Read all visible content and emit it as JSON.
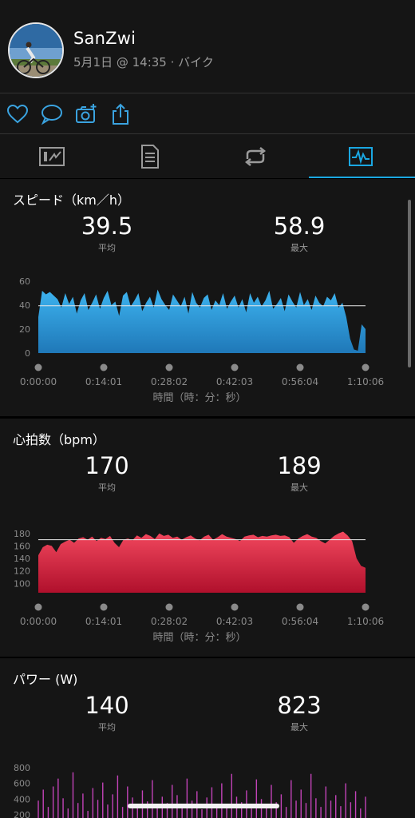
{
  "header": {
    "username": "SanZwi",
    "subtitle": "5月1日 @ 14:35 · バイク"
  },
  "actions": [
    "heart-icon",
    "comment-icon",
    "add-photo-icon",
    "share-icon"
  ],
  "tabs": [
    "summary-icon",
    "details-icon",
    "laps-icon",
    "charts-icon"
  ],
  "active_tab": 3,
  "x_axis_title": "時間（時：分：秒）",
  "sections": {
    "speed": {
      "title": "スピード（km／h）",
      "avg_value": "39.5",
      "avg_label": "平均",
      "max_value": "58.9",
      "max_label": "最大",
      "color": "#2b9bd8"
    },
    "heart_rate": {
      "title": "心拍数（bpm）",
      "avg_value": "170",
      "avg_label": "平均",
      "max_value": "189",
      "max_label": "最大",
      "color": "#e0253f"
    },
    "power": {
      "title": "パワー (W)",
      "avg_value": "140",
      "avg_label": "平均",
      "max_value": "823",
      "max_label": "最大",
      "color": "#c243b8"
    }
  },
  "chart_data": [
    {
      "type": "area",
      "title": "スピード（km／h）",
      "xlabel": "時間（時：分：秒）",
      "ylabel": "",
      "x_ticks": [
        "0:00:00",
        "0:14:01",
        "0:28:02",
        "0:42:03",
        "0:56:04",
        "1:10:06"
      ],
      "y_ticks": [
        0,
        20,
        40,
        60
      ],
      "ylim": [
        0,
        62
      ],
      "avg_line": 39.5,
      "series": [
        {
          "values": [
            30,
            52,
            49,
            51,
            48,
            45,
            38,
            50,
            41,
            47,
            33,
            44,
            50,
            36,
            42,
            49,
            37,
            46,
            52,
            40,
            43,
            31,
            48,
            51,
            39,
            44,
            50,
            35,
            42,
            47,
            38,
            53,
            45,
            40,
            36,
            49,
            44,
            39,
            47,
            33,
            51,
            42,
            38,
            46,
            49,
            36,
            44,
            40,
            50,
            37,
            43,
            48,
            38,
            45,
            34,
            50,
            42,
            47,
            39,
            44,
            52,
            37,
            41,
            46,
            35,
            49,
            43,
            38,
            51,
            40,
            45,
            36,
            48,
            42,
            39,
            47,
            44,
            50,
            38,
            42,
            30,
            12,
            3,
            2,
            24,
            20
          ]
        }
      ]
    },
    {
      "type": "area",
      "title": "心拍数（bpm）",
      "xlabel": "時間（時：分：秒）",
      "ylabel": "",
      "x_ticks": [
        "0:00:00",
        "0:14:01",
        "0:28:02",
        "0:42:03",
        "0:56:04",
        "1:10:06"
      ],
      "y_ticks": [
        100,
        120,
        140,
        160,
        180
      ],
      "ylim": [
        85,
        190
      ],
      "avg_line": 170,
      "series": [
        {
          "values": [
            145,
            158,
            162,
            160,
            150,
            163,
            167,
            170,
            165,
            172,
            174,
            170,
            175,
            168,
            173,
            171,
            176,
            165,
            158,
            170,
            172,
            169,
            177,
            173,
            179,
            176,
            171,
            180,
            176,
            178,
            173,
            175,
            170,
            174,
            177,
            172,
            169,
            175,
            178,
            170,
            174,
            179,
            175,
            173,
            171,
            168,
            175,
            177,
            178,
            174,
            176,
            175,
            177,
            178,
            176,
            177,
            174,
            165,
            172,
            176,
            179,
            175,
            173,
            168,
            164,
            170,
            176,
            180,
            183,
            177,
            168,
            140,
            128,
            125
          ]
        }
      ]
    },
    {
      "type": "bar",
      "title": "パワー (W)",
      "xlabel": "",
      "ylabel": "",
      "y_ticks": [
        200,
        400,
        600,
        800
      ],
      "ylim": [
        200,
        900
      ],
      "series": [
        {
          "values": [
            380,
            520,
            300,
            560,
            660,
            410,
            280,
            740,
            350,
            470,
            250,
            540,
            390,
            610,
            330,
            460,
            700,
            300,
            560,
            420,
            330,
            510,
            370,
            640,
            290,
            430,
            350,
            580,
            450,
            310,
            660,
            380,
            500,
            270,
            420,
            550,
            340,
            600,
            310,
            720,
            430,
            360,
            510,
            280,
            650,
            400,
            330,
            580,
            360,
            460,
            300,
            640,
            380,
            520,
            350,
            720,
            410,
            300,
            560,
            380,
            450,
            310,
            600,
            360,
            500,
            280,
            430
          ]
        }
      ]
    }
  ]
}
